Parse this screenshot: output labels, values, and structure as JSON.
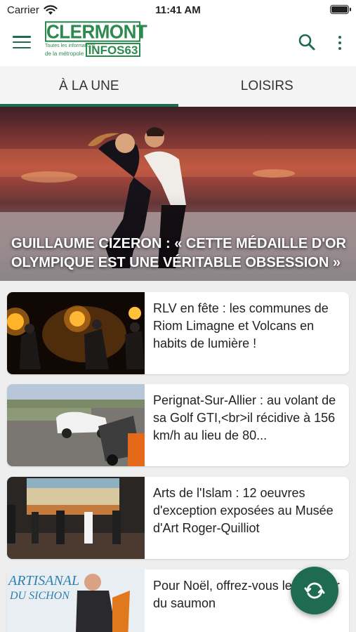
{
  "status_bar": {
    "carrier": "Carrier",
    "time": "11:41 AM"
  },
  "app_bar": {
    "logo": {
      "line1": "CLERMONT",
      "line2": "INFOS63",
      "tagline1": "Toutes les informations",
      "tagline2": "de la métropole"
    }
  },
  "tabs": [
    {
      "label": "À LA UNE",
      "active": true
    },
    {
      "label": "LOISIRS",
      "active": false
    }
  ],
  "hero": {
    "title": "GUILLAUME CIZERON : « CETTE MÉDAILLE D'OR OLYMPIQUE EST UNE VÉRITABLE OBSESSION »"
  },
  "articles": [
    {
      "title": "RLV en fête : les communes de Riom Limagne et Volcans en habits de lumière !"
    },
    {
      "title": "Perignat-Sur-Allier : au volant de sa Golf GTI,<br>il récidive à 156 km/h au lieu de 80..."
    },
    {
      "title": "Arts de l'Islam : 12 oeuvres d'exception exposées au Musée d'Art Roger-Quilliot"
    },
    {
      "title": "Pour Noël, offrez-vous le meilleur du saumon"
    }
  ],
  "thumb_texts": {
    "article4_sign1": "ARTISANAL",
    "article4_sign2": "DU SICHON"
  },
  "colors": {
    "accent": "#1e6b52",
    "logo_green": "#2c8a4e",
    "background": "#eeeeee"
  },
  "icons": {
    "menu": "menu-icon",
    "search": "search-icon",
    "more": "more-vertical-icon",
    "refresh": "refresh-icon",
    "wifi": "wifi-icon",
    "battery": "battery-icon"
  }
}
